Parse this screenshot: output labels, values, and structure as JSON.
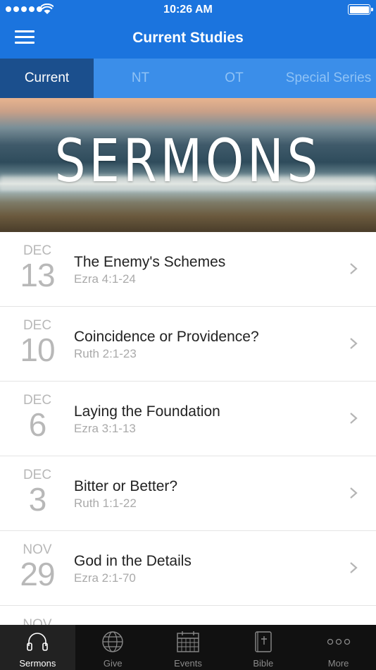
{
  "status": {
    "time": "10:26 AM"
  },
  "nav": {
    "title": "Current Studies"
  },
  "tabs": [
    {
      "label": "Current",
      "active": true
    },
    {
      "label": "NT",
      "active": false
    },
    {
      "label": "OT",
      "active": false
    },
    {
      "label": "Special Series",
      "active": false
    }
  ],
  "banner": {
    "text": "SERMONS"
  },
  "sermons": [
    {
      "month": "DEC",
      "day": "13",
      "title": "The Enemy's Schemes",
      "ref": "Ezra 4:1-24"
    },
    {
      "month": "DEC",
      "day": "10",
      "title": "Coincidence or Providence?",
      "ref": "Ruth 2:1-23"
    },
    {
      "month": "DEC",
      "day": "6",
      "title": "Laying the Foundation",
      "ref": "Ezra 3:1-13"
    },
    {
      "month": "DEC",
      "day": "3",
      "title": "Bitter or Better?",
      "ref": "Ruth 1:1-22"
    },
    {
      "month": "NOV",
      "day": "29",
      "title": "God in the Details",
      "ref": "Ezra 2:1-70"
    },
    {
      "month": "NOV",
      "day": "",
      "title": "",
      "ref": ""
    }
  ],
  "tabbar": [
    {
      "label": "Sermons",
      "icon": "headphones-icon",
      "active": true
    },
    {
      "label": "Give",
      "icon": "globe-icon",
      "active": false
    },
    {
      "label": "Events",
      "icon": "calendar-icon",
      "active": false
    },
    {
      "label": "Bible",
      "icon": "bible-icon",
      "active": false
    },
    {
      "label": "More",
      "icon": "more-dots-icon",
      "active": false
    }
  ]
}
